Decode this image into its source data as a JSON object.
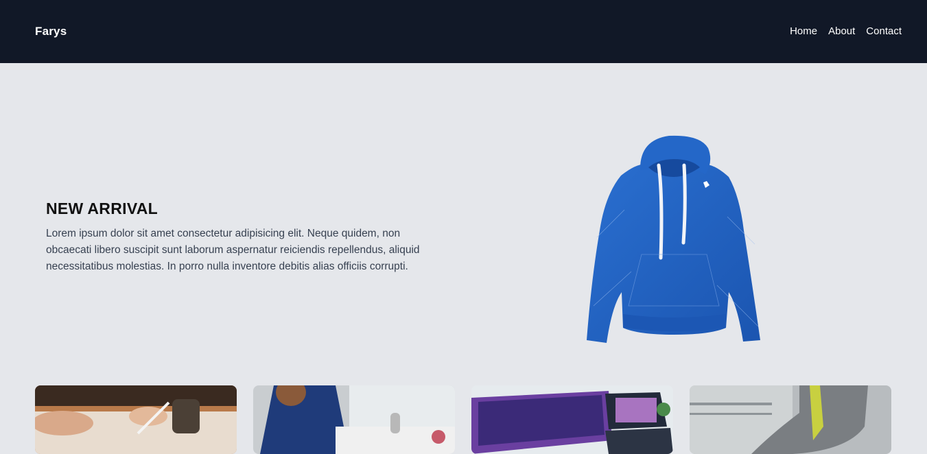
{
  "nav": {
    "brand": "Farys",
    "links": [
      "Home",
      "About",
      "Contact"
    ]
  },
  "hero": {
    "title": "NEW ARRIVAL",
    "text": "Lorem ipsum dolor sit amet consectetur adipisicing elit. Neque quidem, non obcaecati libero suscipit sunt laborum aspernatur reiciendis repellendus, aliquid necessitatibus molestias. In porro nulla inventore debitis alias officiis corrupti.",
    "image": "blue-hoodie-image"
  },
  "cards": [
    {
      "image": "hands-drawing-photo"
    },
    {
      "image": "woman-at-desk-photo"
    },
    {
      "image": "laptop-and-monitor-photo"
    },
    {
      "image": "grey-sneaker-photo"
    }
  ],
  "colors": {
    "nav_bg": "#111827",
    "page_bg": "#e5e7eb",
    "hoodie": "#1e5fc0"
  }
}
